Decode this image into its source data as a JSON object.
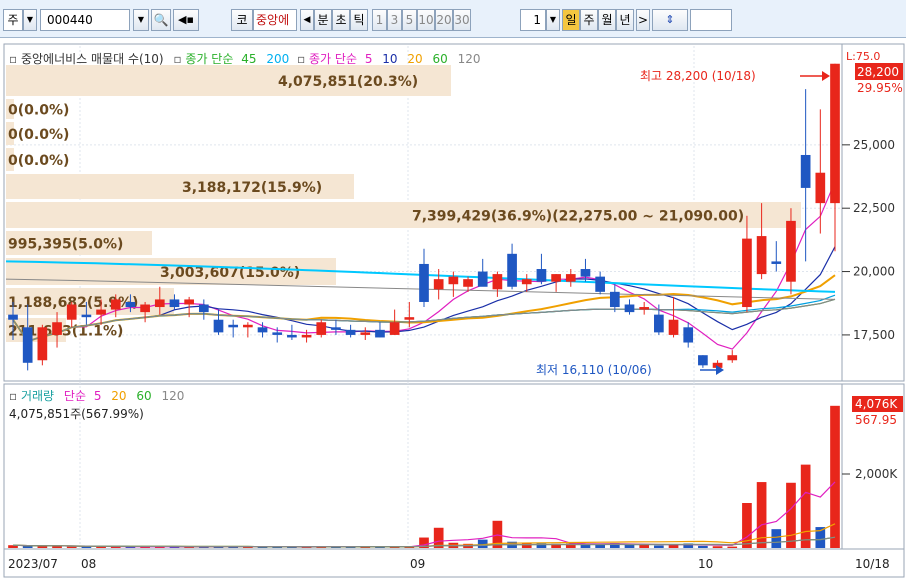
{
  "toolbar": {
    "market_select": "주",
    "code_input": "000440",
    "market_button": "코",
    "stock_name": "중앙에",
    "period_labels": [
      "분",
      "초",
      "틱"
    ],
    "interval_buttons": [
      "1",
      "3",
      "5",
      "10",
      "20",
      "30"
    ],
    "interval_value": "1",
    "period_buttons": [
      "일",
      "주",
      "월",
      "년"
    ],
    "selected_period": "일"
  },
  "upper_panel": {
    "legend": {
      "title": "중앙에너비스 매물대 수(10)",
      "ma_label_a": "종가 단순",
      "ma_a_periods": [
        "45",
        "200"
      ],
      "ma_label_b": "종가 단순",
      "ma_b_periods": [
        "5",
        "10",
        "20",
        "60",
        "120"
      ]
    },
    "right_axis_top": "L:75.0",
    "price_ticks": [
      "25,000",
      "22,500",
      "20,000",
      "17,500"
    ],
    "current_price": "28,200",
    "current_change": "29.95%",
    "high_annotation": "최고 28,200 (10/18)",
    "low_annotation": "최저 16,110 (10/06)",
    "volume_profile_labels": [
      "4,075,851(20.3%)",
      "0(0.0%)",
      "0(0.0%)",
      "0(0.0%)",
      "3,188,172(15.9%)",
      "7,399,429(36.9%)(22,275.00 ~ 21,090.00)",
      "995,395(5.0%)",
      "3,003,607(15.0%)",
      "1,188,682(5.9%)",
      "211,693(1.1%)"
    ]
  },
  "lower_panel": {
    "legend_title": "거래량",
    "legend_ma_label": "단순",
    "legend_ma_periods": [
      "5",
      "20",
      "60",
      "120"
    ],
    "summary": "4,075,851주(567.99%)",
    "right_axis_tick": "2,000K",
    "current_volume": "4,076K",
    "current_ratio": "567.95"
  },
  "x_axis": {
    "labels": [
      "2023/07",
      "08",
      "09",
      "10"
    ],
    "last_date": "10/18"
  },
  "colors": {
    "up": "#e8261b",
    "down": "#1f57c2",
    "profile": "#f5e6d3",
    "profile_text": "#6b4a1f",
    "ma5": "#e020c0",
    "ma10": "#1a2fa8",
    "ma20": "#f0a000",
    "ma60": "#2ab02a",
    "ma120": "#888888",
    "ma45": "#00a0e0",
    "ma200": "#00c8ff"
  },
  "chart_data": {
    "type": "candlestick",
    "price_range": [
      15800,
      28900
    ],
    "ylabel_ticks": [
      25000,
      22500,
      20000,
      17500
    ],
    "candles": [
      {
        "o": 18300,
        "h": 18800,
        "l": 17300,
        "c": 18100
      },
      {
        "o": 17800,
        "h": 18700,
        "l": 16100,
        "c": 16400
      },
      {
        "o": 16500,
        "h": 17900,
        "l": 16300,
        "c": 17800
      },
      {
        "o": 17500,
        "h": 18400,
        "l": 17000,
        "c": 18000
      },
      {
        "o": 18100,
        "h": 18800,
        "l": 17800,
        "c": 18700
      },
      {
        "o": 18300,
        "h": 18800,
        "l": 17900,
        "c": 18200
      },
      {
        "o": 18300,
        "h": 18900,
        "l": 17900,
        "c": 18500
      },
      {
        "o": 18500,
        "h": 19100,
        "l": 18200,
        "c": 18900
      },
      {
        "o": 18800,
        "h": 19100,
        "l": 18400,
        "c": 18600
      },
      {
        "o": 18400,
        "h": 18800,
        "l": 18000,
        "c": 18700
      },
      {
        "o": 18600,
        "h": 19400,
        "l": 18300,
        "c": 18900
      },
      {
        "o": 18900,
        "h": 19100,
        "l": 18500,
        "c": 18600
      },
      {
        "o": 18700,
        "h": 19000,
        "l": 18200,
        "c": 18900
      },
      {
        "o": 18700,
        "h": 18900,
        "l": 18100,
        "c": 18400
      },
      {
        "o": 18100,
        "h": 18500,
        "l": 17500,
        "c": 17600
      },
      {
        "o": 17900,
        "h": 18100,
        "l": 17400,
        "c": 17800
      },
      {
        "o": 17800,
        "h": 18000,
        "l": 17400,
        "c": 17900
      },
      {
        "o": 17800,
        "h": 18000,
        "l": 17400,
        "c": 17600
      },
      {
        "o": 17600,
        "h": 17800,
        "l": 17200,
        "c": 17500
      },
      {
        "o": 17500,
        "h": 17900,
        "l": 17300,
        "c": 17400
      },
      {
        "o": 17400,
        "h": 17700,
        "l": 17200,
        "c": 17500
      },
      {
        "o": 17500,
        "h": 18100,
        "l": 17400,
        "c": 18000
      },
      {
        "o": 17800,
        "h": 18100,
        "l": 17500,
        "c": 17700
      },
      {
        "o": 17700,
        "h": 17900,
        "l": 17400,
        "c": 17500
      },
      {
        "o": 17500,
        "h": 17800,
        "l": 17300,
        "c": 17600
      },
      {
        "o": 17700,
        "h": 18000,
        "l": 17400,
        "c": 17400
      },
      {
        "o": 17500,
        "h": 18500,
        "l": 17500,
        "c": 18000
      },
      {
        "o": 18100,
        "h": 18800,
        "l": 17800,
        "c": 18200
      },
      {
        "o": 20300,
        "h": 20900,
        "l": 18600,
        "c": 18800
      },
      {
        "o": 19300,
        "h": 20100,
        "l": 18900,
        "c": 19700
      },
      {
        "o": 19500,
        "h": 20000,
        "l": 19000,
        "c": 19800
      },
      {
        "o": 19400,
        "h": 19800,
        "l": 19200,
        "c": 19700
      },
      {
        "o": 20000,
        "h": 20500,
        "l": 19600,
        "c": 19400
      },
      {
        "o": 19300,
        "h": 20000,
        "l": 19000,
        "c": 19900
      },
      {
        "o": 20700,
        "h": 21100,
        "l": 19300,
        "c": 19400
      },
      {
        "o": 19500,
        "h": 19900,
        "l": 19200,
        "c": 19700
      },
      {
        "o": 20100,
        "h": 20700,
        "l": 19500,
        "c": 19600
      },
      {
        "o": 19600,
        "h": 19900,
        "l": 19200,
        "c": 19900
      },
      {
        "o": 19600,
        "h": 20100,
        "l": 19400,
        "c": 19900
      },
      {
        "o": 20100,
        "h": 20500,
        "l": 19600,
        "c": 19800
      },
      {
        "o": 19800,
        "h": 20000,
        "l": 19100,
        "c": 19200
      },
      {
        "o": 19200,
        "h": 19500,
        "l": 18400,
        "c": 18600
      },
      {
        "o": 18700,
        "h": 18900,
        "l": 18300,
        "c": 18400
      },
      {
        "o": 18500,
        "h": 18800,
        "l": 18300,
        "c": 18600
      },
      {
        "o": 18300,
        "h": 18700,
        "l": 17500,
        "c": 17600
      },
      {
        "o": 17500,
        "h": 19000,
        "l": 17400,
        "c": 18100
      },
      {
        "o": 17800,
        "h": 18000,
        "l": 17000,
        "c": 17200
      },
      {
        "o": 16700,
        "h": 16700,
        "l": 16200,
        "c": 16300
      },
      {
        "o": 16200,
        "h": 16500,
        "l": 16110,
        "c": 16400
      },
      {
        "o": 16500,
        "h": 16900,
        "l": 16400,
        "c": 16700
      },
      {
        "o": 18600,
        "h": 22200,
        "l": 18400,
        "c": 21300
      },
      {
        "o": 19900,
        "h": 22700,
        "l": 19700,
        "c": 21400
      },
      {
        "o": 20400,
        "h": 21200,
        "l": 20000,
        "c": 20300
      },
      {
        "o": 19600,
        "h": 22500,
        "l": 19100,
        "c": 22000
      },
      {
        "o": 24600,
        "h": 27200,
        "l": 20400,
        "c": 23300
      },
      {
        "o": 22700,
        "h": 26400,
        "l": 21500,
        "c": 23900
      },
      {
        "o": 22700,
        "h": 28200,
        "l": 20800,
        "c": 28200
      }
    ],
    "volume_ymax": 4300000,
    "volumes": [
      80,
      60,
      50,
      60,
      40,
      40,
      35,
      40,
      30,
      30,
      40,
      30,
      30,
      30,
      50,
      40,
      30,
      30,
      30,
      30,
      30,
      40,
      30,
      30,
      30,
      30,
      35,
      35,
      300,
      580,
      150,
      120,
      240,
      780,
      180,
      130,
      130,
      120,
      130,
      110,
      110,
      140,
      90,
      90,
      70,
      100,
      130,
      60,
      50,
      40,
      1290,
      1890,
      540,
      1870,
      2390,
      600,
      4076
    ],
    "volume_up": [
      1,
      0,
      1,
      1,
      1,
      0,
      1,
      1,
      0,
      1,
      1,
      0,
      1,
      0,
      0,
      0,
      1,
      0,
      0,
      0,
      1,
      1,
      0,
      0,
      1,
      0,
      1,
      1,
      1,
      1,
      1,
      1,
      0,
      1,
      0,
      1,
      0,
      1,
      1,
      0,
      0,
      0,
      0,
      1,
      0,
      1,
      0,
      0,
      1,
      1,
      1,
      1,
      0,
      1,
      1,
      0,
      1
    ]
  }
}
